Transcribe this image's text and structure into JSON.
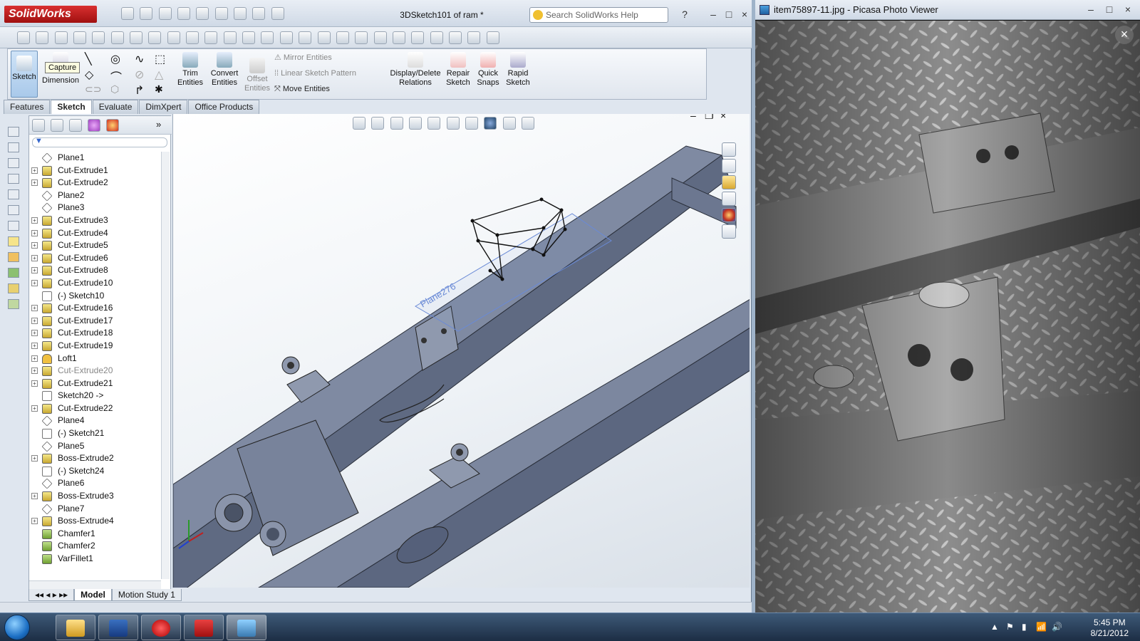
{
  "solidworks": {
    "app_name": "SolidWorks",
    "document_title": "3DSketch101 of ram *",
    "help_search_placeholder": "Search SolidWorks Help",
    "command_manager": {
      "sketch": "Sketch",
      "capture_tooltip": "Capture",
      "smart_dimension": "Dimension",
      "trim_entities": [
        "Trim",
        "Entities"
      ],
      "convert_entities": [
        "Convert",
        "Entities"
      ],
      "offset_entities": [
        "Offset",
        "Entities"
      ],
      "mirror_entities": "Mirror Entities",
      "linear_sketch_pattern": "Linear Sketch Pattern",
      "move_entities": "Move Entities",
      "display_delete_relations": [
        "Display/Delete",
        "Relations"
      ],
      "repair_sketch": [
        "Repair",
        "Sketch"
      ],
      "quick_snaps": [
        "Quick",
        "Snaps"
      ],
      "rapid_sketch": [
        "Rapid",
        "Sketch"
      ]
    },
    "tabs": [
      "Features",
      "Sketch",
      "Evaluate",
      "DimXpert",
      "Office Products"
    ],
    "active_tab": "Sketch",
    "feature_tree": [
      {
        "label": "Plane1",
        "icon": "plane-icon",
        "expandable": false
      },
      {
        "label": "Cut-Extrude1",
        "icon": "cut-extrude-icon",
        "expandable": true
      },
      {
        "label": "Cut-Extrude2",
        "icon": "cut-extrude-icon",
        "expandable": true
      },
      {
        "label": "Plane2",
        "icon": "plane-icon",
        "expandable": false
      },
      {
        "label": "Plane3",
        "icon": "plane-icon",
        "expandable": false
      },
      {
        "label": "Cut-Extrude3",
        "icon": "cut-extrude-icon",
        "expandable": true
      },
      {
        "label": "Cut-Extrude4",
        "icon": "cut-extrude-icon",
        "expandable": true
      },
      {
        "label": "Cut-Extrude5",
        "icon": "cut-extrude-icon",
        "expandable": true
      },
      {
        "label": "Cut-Extrude6",
        "icon": "cut-extrude-icon",
        "expandable": true
      },
      {
        "label": "Cut-Extrude8",
        "icon": "cut-extrude-icon",
        "expandable": true
      },
      {
        "label": "Cut-Extrude10",
        "icon": "cut-extrude-icon",
        "expandable": true
      },
      {
        "label": "(-) Sketch10",
        "icon": "sketch-icon",
        "expandable": false
      },
      {
        "label": "Cut-Extrude16",
        "icon": "cut-extrude-icon",
        "expandable": true
      },
      {
        "label": "Cut-Extrude17",
        "icon": "cut-extrude-icon",
        "expandable": true
      },
      {
        "label": "Cut-Extrude18",
        "icon": "cut-extrude-icon",
        "expandable": true
      },
      {
        "label": "Cut-Extrude19",
        "icon": "cut-extrude-icon",
        "expandable": true
      },
      {
        "label": "Loft1",
        "icon": "loft-icon",
        "expandable": true
      },
      {
        "label": "Cut-Extrude20",
        "icon": "cut-extrude-icon",
        "expandable": true,
        "suppressed": true
      },
      {
        "label": "Cut-Extrude21",
        "icon": "cut-extrude-icon",
        "expandable": true
      },
      {
        "label": "Sketch20 ->",
        "icon": "sketch-icon",
        "expandable": false
      },
      {
        "label": "Cut-Extrude22",
        "icon": "cut-extrude-icon",
        "expandable": true
      },
      {
        "label": "Plane4",
        "icon": "plane-icon",
        "expandable": false
      },
      {
        "label": "(-) Sketch21",
        "icon": "sketch-icon",
        "expandable": false
      },
      {
        "label": "Plane5",
        "icon": "plane-icon",
        "expandable": false
      },
      {
        "label": "Boss-Extrude2",
        "icon": "boss-extrude-icon",
        "expandable": true
      },
      {
        "label": "(-) Sketch24",
        "icon": "sketch-icon",
        "expandable": false
      },
      {
        "label": "Plane6",
        "icon": "plane-icon",
        "expandable": false
      },
      {
        "label": "Boss-Extrude3",
        "icon": "boss-extrude-icon",
        "expandable": true
      },
      {
        "label": "Plane7",
        "icon": "plane-icon",
        "expandable": false
      },
      {
        "label": "Boss-Extrude4",
        "icon": "boss-extrude-icon",
        "expandable": true
      },
      {
        "label": "Chamfer1",
        "icon": "chamfer-icon",
        "expandable": false
      },
      {
        "label": "Chamfer2",
        "icon": "chamfer-icon",
        "expandable": false
      },
      {
        "label": "VarFillet1",
        "icon": "fillet-icon",
        "expandable": false
      }
    ],
    "viewport_plane_label": "Plane276",
    "bottom_tabs": [
      "Model",
      "Motion Study 1"
    ],
    "active_bottom_tab": "Model"
  },
  "picasa": {
    "title": "item75897-11.jpg - Picasa Photo Viewer",
    "close_glyph": "×"
  },
  "taskbar": {
    "time": "5:45 PM",
    "date": "8/21/2012",
    "pinned": [
      "explorer-icon",
      "activity-monitor-icon",
      "opera-icon",
      "solidworks-icon",
      "picasa-icon"
    ]
  },
  "colors": {
    "sw_red": "#c01818",
    "model_steel": "#6f7c95",
    "sketch_blue": "#5a7fd0"
  }
}
